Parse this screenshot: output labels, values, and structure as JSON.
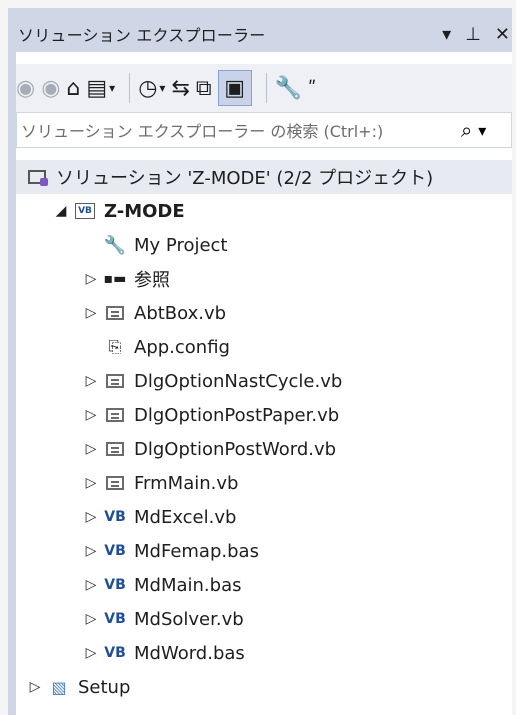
{
  "window": {
    "title": "ソリューション エクスプローラー"
  },
  "title_buttons": [
    {
      "name": "dropdown-icon",
      "glyph": "▼"
    },
    {
      "name": "pin-icon",
      "glyph": "ᴘ"
    },
    {
      "name": "close-icon",
      "glyph": "✕"
    }
  ],
  "toolbar": {
    "back": "◀",
    "forward": "▶",
    "home": "⌂",
    "sync": "⇆",
    "wrench": "🔧",
    "more": "⋮"
  },
  "search": {
    "placeholder": "ソリューション エクスプローラー の検索 (Ctrl+:)",
    "search_icon": "⌕",
    "caret": "▾"
  },
  "tree": {
    "solution_label": "ソリューション 'Z-MODE' (2/2 プロジェクト)",
    "project": {
      "label": "Z-MODE",
      "arrow": "◢"
    },
    "items": [
      {
        "label": "My Project",
        "icon": "wrench-icon",
        "arrow": ""
      },
      {
        "label": "参照",
        "icon": "references-icon",
        "arrow": "▷"
      },
      {
        "label": "AbtBox.vb",
        "icon": "form-icon",
        "arrow": "▷"
      },
      {
        "label": "App.config",
        "icon": "config-icon",
        "arrow": ""
      },
      {
        "label": "DlgOptionNastCycle.vb",
        "icon": "form-icon",
        "arrow": "▷"
      },
      {
        "label": "DlgOptionPostPaper.vb",
        "icon": "form-icon",
        "arrow": "▷"
      },
      {
        "label": "DlgOptionPostWord.vb",
        "icon": "form-icon",
        "arrow": "▷"
      },
      {
        "label": "FrmMain.vb",
        "icon": "form-icon",
        "arrow": "▷"
      },
      {
        "label": "MdExcel.vb",
        "icon": "vb-icon",
        "arrow": "▷"
      },
      {
        "label": "MdFemap.bas",
        "icon": "vb-icon",
        "arrow": "▷"
      },
      {
        "label": "MdMain.bas",
        "icon": "vb-icon",
        "arrow": "▷"
      },
      {
        "label": "MdSolver.vb",
        "icon": "vb-icon",
        "arrow": "▷"
      },
      {
        "label": "MdWord.bas",
        "icon": "vb-icon",
        "arrow": "▷"
      }
    ],
    "setup": {
      "label": "Setup",
      "arrow": "▷"
    }
  },
  "colors": {
    "titlebar_bg": "#cfd6e5",
    "toolbar_bg": "#eef0f5",
    "selected_row_bg": "#e7eaf0",
    "vb_blue": "#1f4f96"
  }
}
